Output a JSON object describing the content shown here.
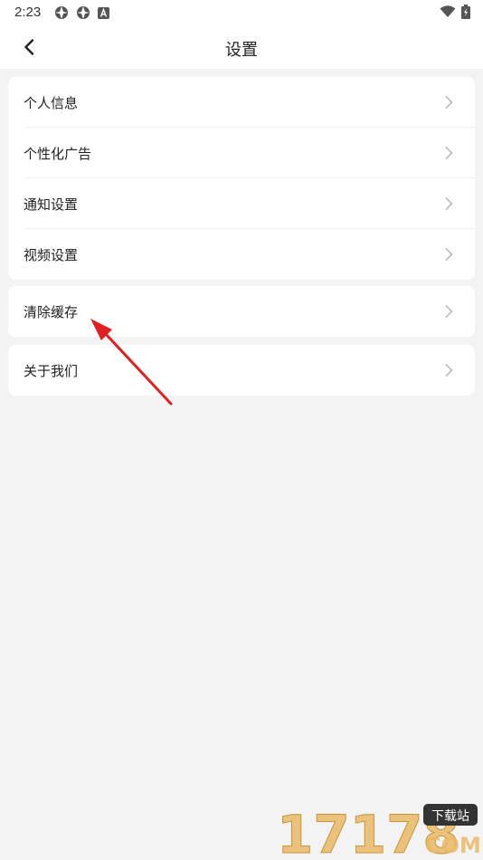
{
  "status_bar": {
    "time": "2:23",
    "left_icons": [
      "aperture-icon",
      "aperture-icon",
      "a-badge-icon"
    ],
    "right_icons": [
      "wifi-icon",
      "battery-charging-icon"
    ]
  },
  "header": {
    "title": "设置",
    "back_icon": "chevron-left-icon"
  },
  "settings_groups": [
    {
      "items": [
        {
          "label": "个人信息"
        },
        {
          "label": "个性化广告"
        },
        {
          "label": "通知设置"
        },
        {
          "label": "视频设置"
        }
      ]
    },
    {
      "items": [
        {
          "label": "清除缓存"
        }
      ]
    },
    {
      "items": [
        {
          "label": "关于我们"
        }
      ]
    }
  ],
  "colors": {
    "background": "#f3f3f3",
    "card": "#ffffff",
    "text": "#222222",
    "chevron": "#b5b5b5",
    "annotation_arrow": "#e02020"
  },
  "watermark": {
    "number": "17178",
    "tag": "下载站",
    "domain": "COM"
  }
}
